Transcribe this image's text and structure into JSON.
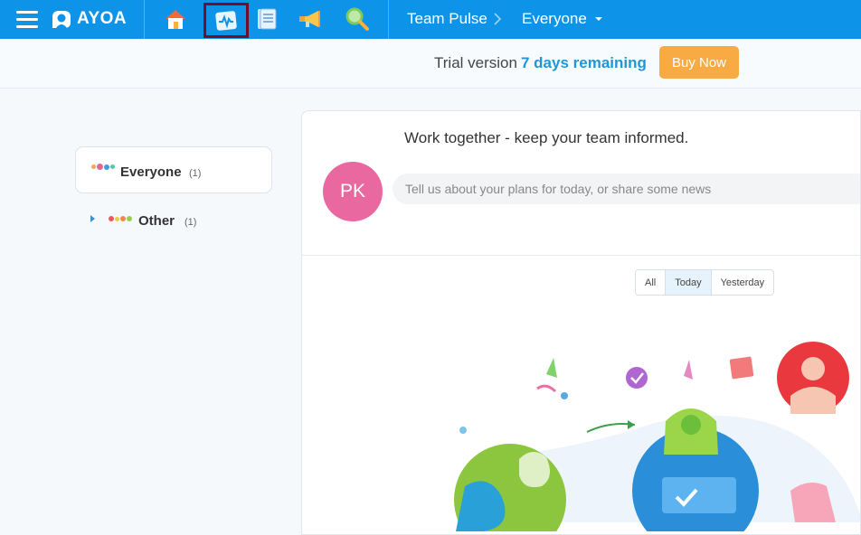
{
  "app": {
    "name": "AYOA"
  },
  "breadcrumb": {
    "section": "Team Pulse",
    "group": "Everyone"
  },
  "nav": {
    "icons": [
      "home-icon",
      "pulse-icon",
      "notes-icon",
      "megaphone-icon",
      "search-icon"
    ],
    "active": "pulse-icon"
  },
  "trial": {
    "label": "Trial version",
    "remaining": "7 days remaining",
    "buy_label": "Buy Now"
  },
  "sidebar": {
    "groups": [
      {
        "label": "Everyone",
        "count": "(1)",
        "selected": true
      },
      {
        "label": "Other",
        "count": "(1)",
        "selected": false
      }
    ]
  },
  "pulse": {
    "heading": "Work together - keep your team informed.",
    "avatar_initials": "PK",
    "post_placeholder": "Tell us about your plans for today, or share some news",
    "filters": [
      "All",
      "Today",
      "Yesterday"
    ],
    "selected_filter": "Today"
  },
  "colors": {
    "topbar": "#0d93e8",
    "accent": "#1e97d6",
    "buy": "#f8aa43",
    "avatar": "#e9689f"
  }
}
